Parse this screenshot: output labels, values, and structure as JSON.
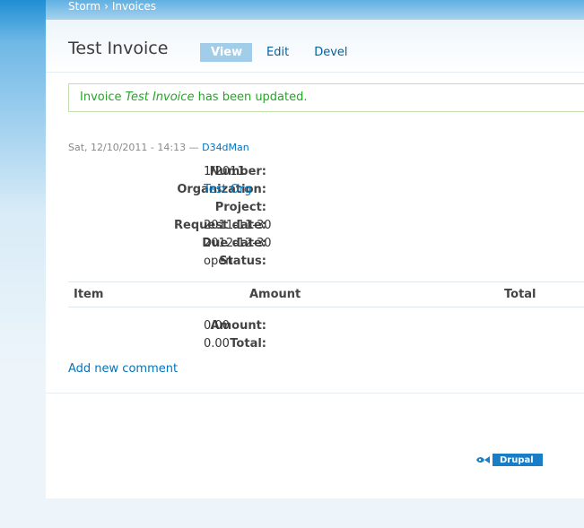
{
  "breadcrumb": {
    "items": [
      "Storm",
      "Invoices"
    ],
    "separator": "›"
  },
  "page": {
    "title": "Test Invoice"
  },
  "tabs": [
    {
      "label": "View",
      "active": true
    },
    {
      "label": "Edit",
      "active": false
    },
    {
      "label": "Devel",
      "active": false
    }
  ],
  "message": {
    "prefix": "Invoice ",
    "name": "Test Invoice",
    "suffix": " has been updated."
  },
  "submitted": {
    "date": "Sat, 12/10/2011 - 14:13",
    "dash": " — ",
    "author": "D34dMan"
  },
  "fields": [
    {
      "label": "Number:",
      "value": "1/2011",
      "link": false
    },
    {
      "label": "Organization:",
      "value": "Test Org",
      "link": true
    },
    {
      "label": "Project:",
      "value": "",
      "link": false
    },
    {
      "label": "Request date:",
      "value": "2011-11-30",
      "link": false
    },
    {
      "label": "Due date:",
      "value": "2012-12-30",
      "link": false
    },
    {
      "label": "Status:",
      "value": "open",
      "link": false
    }
  ],
  "items_table": {
    "headers": [
      "Item",
      "Amount",
      "Total"
    ]
  },
  "totals": [
    {
      "label": "Amount:",
      "value": "0.00"
    },
    {
      "label": "Total:",
      "value": "0.00"
    }
  ],
  "comment": {
    "add_label": "Add new comment"
  },
  "footer": {
    "badge_label": "Drupal"
  },
  "colors": {
    "link": "#0074bd",
    "message_text": "#25a625",
    "tab_active_bg": "#a2cde9",
    "header_blue": "#1f8fd3"
  }
}
